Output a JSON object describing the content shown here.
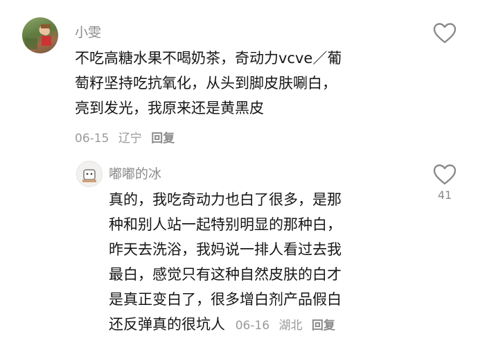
{
  "comments": [
    {
      "username": "小雯",
      "lines": [
        "不吃高糖水果不喝奶茶，奇动力vcve／葡",
        "萄籽坚持吃抗氧化，从头到脚皮肤唰白，",
        "亮到发光，我原来还是黄黑皮"
      ],
      "date": "06-15",
      "location": "辽宁",
      "reply_label": "回复",
      "like_count": ""
    },
    {
      "username": "嘟嘟的冰",
      "lines": [
        "真的，我吃奇动力也白了很多，是那",
        "种和别人站一起特别明显的那种白，",
        "昨天去洗浴，我妈说一排人看过去我",
        "最白，感觉只有这种自然皮肤的白才",
        "是真正变白了，很多增白剂产品假白",
        "还反弹真的很坑人"
      ],
      "date": "06-16",
      "location": "湖北",
      "reply_label": "回复",
      "like_count": "41"
    }
  ],
  "icons": {
    "like": "heart-outline-icon"
  },
  "colors": {
    "text": "#161616",
    "muted": "#8a8a8a"
  }
}
